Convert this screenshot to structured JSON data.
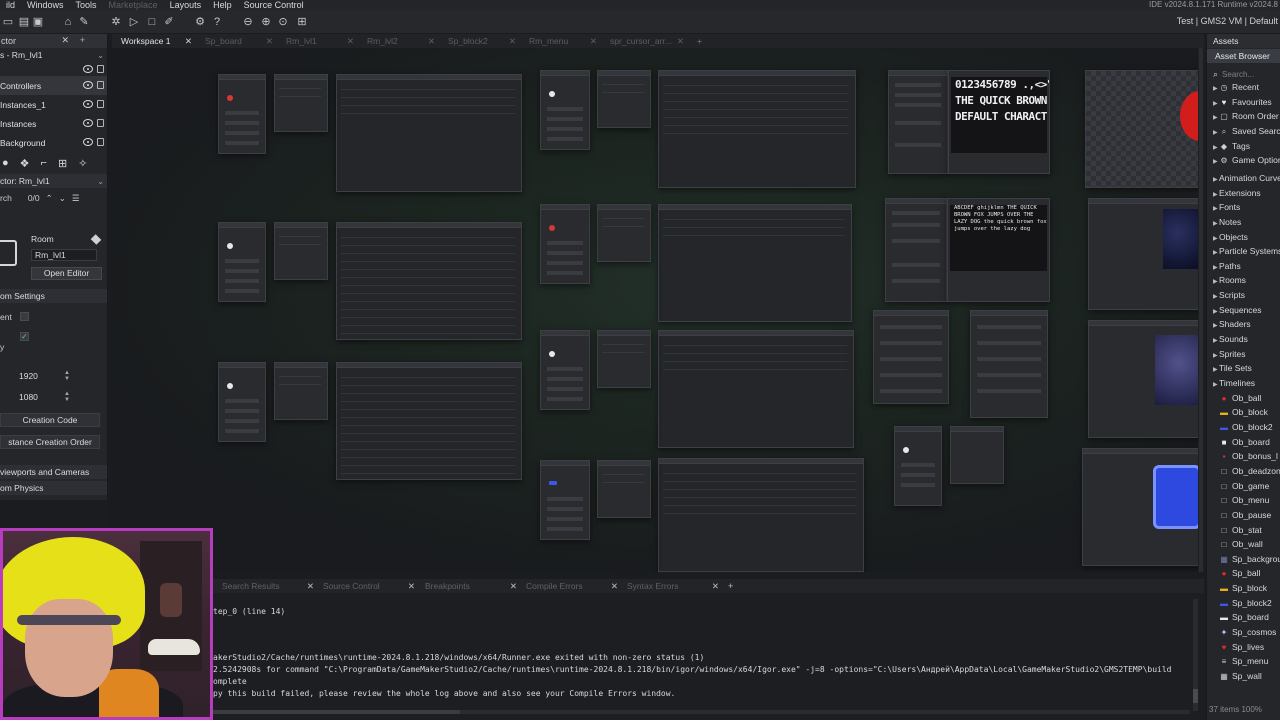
{
  "menu": {
    "items": [
      "ild",
      "Windows",
      "Tools",
      "Marketplace",
      "Layouts",
      "Help",
      "Source Control"
    ],
    "disabled": [
      "Marketplace"
    ],
    "ide_version": "IDE v2024.8.1.171  Runtime v2024.8"
  },
  "toolbar": {
    "target": "Test | GMS2 VM | Default"
  },
  "left_panel": {
    "tab_title": "ctor",
    "room_title": "s - Rm_lvl1",
    "layers": [
      "Controllers",
      "Instances_1",
      "Instances",
      "Background"
    ],
    "selected_layer": "Controllers",
    "inspector_title": "ctor: Rm_lvl1",
    "search_label": "rch",
    "search_count": "0/0",
    "room_label": "Room",
    "room_name": "Rm_lvl1",
    "open_editor": "Open Editor",
    "room_settings": "om Settings",
    "persistent_label": "ent",
    "clear_label": "y",
    "width": "1920",
    "height": "1080",
    "creation_code": "Creation Code",
    "creation_order": "stance Creation Order",
    "viewports": "viewports and Cameras",
    "physics": "om Physics"
  },
  "workspace": {
    "tabs": [
      {
        "label": "Workspace 1",
        "active": true
      },
      {
        "label": "Sp_board",
        "active": false
      },
      {
        "label": "Rm_lvl1",
        "active": false
      },
      {
        "label": "Rm_lvl2",
        "active": false
      },
      {
        "label": "Sp_block2",
        "active": false
      },
      {
        "label": "Rm_menu",
        "active": false
      },
      {
        "label": "spr_cursor_arr...",
        "active": false
      }
    ],
    "font_preview_1": [
      "0123456789 .,<>\"",
      "THE QUICK BROWN",
      "DEFAULT CHARACT"
    ],
    "font_preview_2": "ABCDEF ghijklmn THE QUICK BROWN FOX JUMPS OVER THE LAZY DOG the quick brown fox jumps over the lazy dog"
  },
  "assets": {
    "tab": "Assets",
    "browser": "Asset Browser",
    "search_placeholder": "Search...",
    "items": [
      {
        "label": "Recent",
        "icon": "clock-icon",
        "color": "#cfd0d4",
        "tri": true
      },
      {
        "label": "Favourites",
        "icon": "heart-icon",
        "color": "#e8e8ea",
        "tri": true
      },
      {
        "label": "Room Order",
        "icon": "room-icon",
        "color": "#cfd0d4",
        "tri": true
      },
      {
        "label": "Saved Searches",
        "icon": "search-icon",
        "color": "#cfd0d4",
        "tri": true
      },
      {
        "label": "Tags",
        "icon": "tag-icon",
        "color": "#cfd0d4",
        "tri": true
      },
      {
        "label": "Game Options",
        "icon": "gear-icon",
        "color": "#cfd0d4",
        "tri": true
      },
      {
        "label": "Animation Curves",
        "icon": "folder-icon",
        "color": "#cfd0d4",
        "tri": true
      },
      {
        "label": "Extensions",
        "icon": "folder-icon",
        "color": "#cfd0d4",
        "tri": true
      },
      {
        "label": "Fonts",
        "icon": "folder-icon",
        "color": "#cfd0d4",
        "tri": true
      },
      {
        "label": "Notes",
        "icon": "folder-icon",
        "color": "#cfd0d4",
        "tri": true
      },
      {
        "label": "Objects",
        "icon": "folder-icon",
        "color": "#cfd0d4",
        "tri": true
      },
      {
        "label": "Particle Systems",
        "icon": "folder-icon",
        "color": "#cfd0d4",
        "tri": true
      },
      {
        "label": "Paths",
        "icon": "folder-icon",
        "color": "#cfd0d4",
        "tri": true
      },
      {
        "label": "Rooms",
        "icon": "folder-icon",
        "color": "#cfd0d4",
        "tri": true
      },
      {
        "label": "Scripts",
        "icon": "folder-icon",
        "color": "#cfd0d4",
        "tri": true
      },
      {
        "label": "Sequences",
        "icon": "folder-icon",
        "color": "#cfd0d4",
        "tri": true
      },
      {
        "label": "Shaders",
        "icon": "folder-icon",
        "color": "#cfd0d4",
        "tri": true
      },
      {
        "label": "Sounds",
        "icon": "folder-icon",
        "color": "#cfd0d4",
        "tri": true
      },
      {
        "label": "Sprites",
        "icon": "folder-icon",
        "color": "#cfd0d4",
        "tri": true
      },
      {
        "label": "Tile Sets",
        "icon": "folder-icon",
        "color": "#cfd0d4",
        "tri": true
      },
      {
        "label": "Timelines",
        "icon": "folder-icon",
        "color": "#cfd0d4",
        "tri": true
      },
      {
        "label": "Ob_ball",
        "icon": "red-dot-icon",
        "color": "#e02b2b",
        "tri": false
      },
      {
        "label": "Ob_block",
        "icon": "yellow-bar-icon",
        "color": "#e0b020",
        "tri": false
      },
      {
        "label": "Ob_block2",
        "icon": "blue-bar-icon",
        "color": "#3f55e6",
        "tri": false
      },
      {
        "label": "Ob_board",
        "icon": "white-square-icon",
        "color": "#e8e8ea",
        "tri": false
      },
      {
        "label": "Ob_bonus_l",
        "icon": "red-square-icon",
        "color": "#d23a3a",
        "tri": false
      },
      {
        "label": "Ob_deadzone",
        "icon": "object-icon",
        "color": "#cfd0d4",
        "tri": false
      },
      {
        "label": "Ob_game",
        "icon": "object-icon",
        "color": "#cfd0d4",
        "tri": false
      },
      {
        "label": "Ob_menu",
        "icon": "object-icon",
        "color": "#cfd0d4",
        "tri": false
      },
      {
        "label": "Ob_pause",
        "icon": "object-icon",
        "color": "#cfd0d4",
        "tri": false
      },
      {
        "label": "Ob_stat",
        "icon": "object-icon",
        "color": "#cfd0d4",
        "tri": false
      },
      {
        "label": "Ob_wall",
        "icon": "object-icon",
        "color": "#cfd0d4",
        "tri": false
      },
      {
        "label": "Sp_background",
        "icon": "sprite-icon",
        "color": "#6f7bb0",
        "tri": false
      },
      {
        "label": "Sp_ball",
        "icon": "red-dot-icon",
        "color": "#e02b2b",
        "tri": false
      },
      {
        "label": "Sp_block",
        "icon": "yellow-bar-icon",
        "color": "#e0b020",
        "tri": false
      },
      {
        "label": "Sp_block2",
        "icon": "blue-bar-icon",
        "color": "#3f55e6",
        "tri": false
      },
      {
        "label": "Sp_board",
        "icon": "white-bar-icon",
        "color": "#e8e8ea",
        "tri": false
      },
      {
        "label": "Sp_cosmos",
        "icon": "star-icon",
        "color": "#c9c0f0",
        "tri": false
      },
      {
        "label": "Sp_lives",
        "icon": "heart-icon",
        "color": "#e02b2b",
        "tri": false
      },
      {
        "label": "Sp_menu",
        "icon": "menu-icon",
        "color": "#cfd0d4",
        "tri": false
      },
      {
        "label": "Sp_wall",
        "icon": "grid-icon",
        "color": "#cfd0d4",
        "tri": false
      }
    ],
    "footer": "37 items  100%"
  },
  "output": {
    "tabs": [
      "Search Results",
      "Source Control",
      "Breakpoints",
      "Compile Errors",
      "Syntax Errors"
    ],
    "lines": [
      "tep_0 (line 14)",
      "",
      "",
      "",
      "akerStudio2/Cache/runtimes\\runtime-2024.8.1.218/windows/x64/Runner.exe exited with non-zero status (1)",
      "2.5242908s for command \"C:\\ProgramData/GameMakerStudio2/Cache/runtimes\\runtime-2024.8.1.218/bin/igor/windows/x64/Igor.exe\" -j=8  -options=\"C:\\Users\\Андрей\\AppData\\Local\\GameMakerStudio2\\GMS2TEMP\\build",
      "omplete",
      "py this build failed, please review the whole log above and also see your Compile Errors window."
    ]
  }
}
